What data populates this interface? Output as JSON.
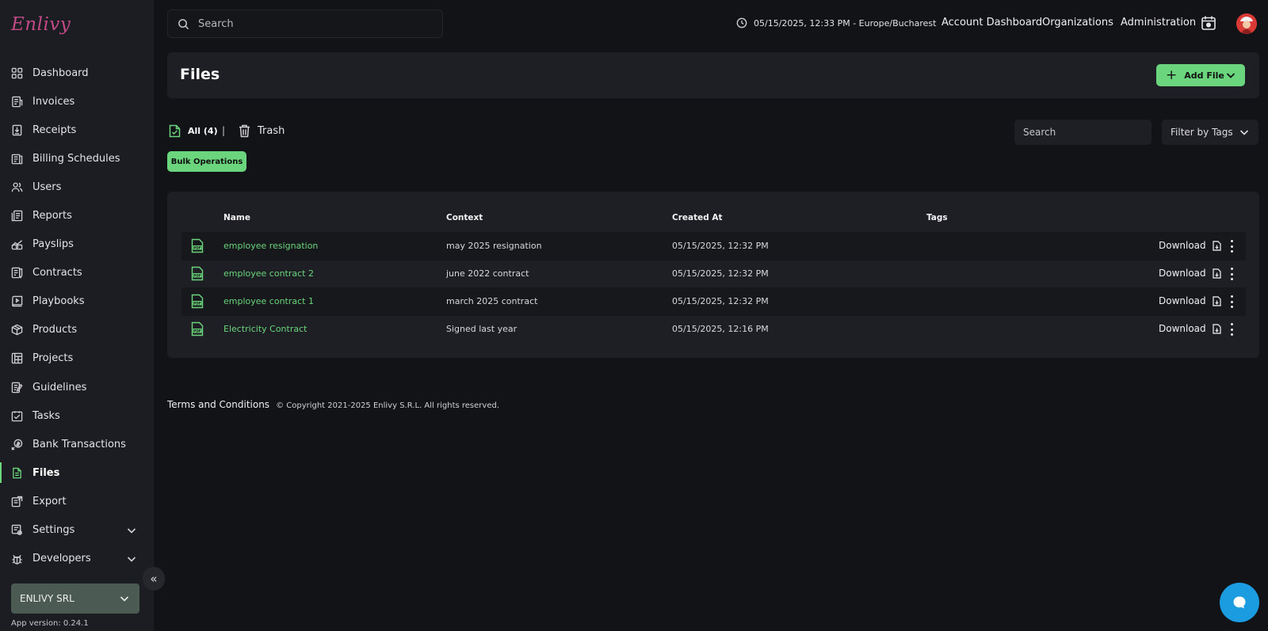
{
  "app": {
    "logo_text": "Enlivy",
    "org_name": "ENLIVY SRL",
    "app_version": "App version: 0.24.1"
  },
  "sidebar": {
    "items": [
      {
        "label": "Dashboard",
        "icon": "dashboard-icon"
      },
      {
        "label": "Invoices",
        "icon": "invoice-icon"
      },
      {
        "label": "Receipts",
        "icon": "receipt-icon"
      },
      {
        "label": "Billing Schedules",
        "icon": "billing-schedule-icon"
      },
      {
        "label": "Users",
        "icon": "users-icon"
      },
      {
        "label": "Reports",
        "icon": "reports-icon"
      },
      {
        "label": "Payslips",
        "icon": "payslips-icon"
      },
      {
        "label": "Contracts",
        "icon": "contracts-icon"
      },
      {
        "label": "Playbooks",
        "icon": "playbooks-icon"
      },
      {
        "label": "Products",
        "icon": "products-icon"
      },
      {
        "label": "Projects",
        "icon": "projects-icon"
      },
      {
        "label": "Guidelines",
        "icon": "guidelines-icon"
      },
      {
        "label": "Tasks",
        "icon": "tasks-icon"
      },
      {
        "label": "Bank Transactions",
        "icon": "bank-transactions-icon"
      },
      {
        "label": "Files",
        "icon": "files-icon",
        "active": true
      },
      {
        "label": "Export",
        "icon": "export-icon"
      },
      {
        "label": "Settings",
        "icon": "settings-icon",
        "expandable": true
      },
      {
        "label": "Developers",
        "icon": "developers-icon",
        "expandable": true
      }
    ]
  },
  "topbar": {
    "search_placeholder": "Search",
    "datetime": "05/15/2025, 12:33 PM  -  Europe/Bucharest",
    "nav": [
      "Account Dashboard",
      "Organizations",
      "Administration"
    ]
  },
  "page": {
    "title": "Files",
    "add_file_label": "Add File",
    "tab_all_label": "All (4)",
    "tab_separator": "|",
    "tab_trash_label": "Trash",
    "bulk_label": "Bulk Operations",
    "search_placeholder": "Search",
    "filter_tags_label": "Filter by Tags"
  },
  "table": {
    "headers": [
      "Name",
      "Context",
      "Created At",
      "Tags"
    ],
    "download_label": "Download",
    "rows": [
      {
        "name": "employee resignation",
        "context": "may 2025 resignation",
        "created_at": "05/15/2025, 12:32 PM",
        "tags": ""
      },
      {
        "name": "employee contract 2",
        "context": "june 2022 contract",
        "created_at": "05/15/2025, 12:32 PM",
        "tags": ""
      },
      {
        "name": "employee contract 1",
        "context": "march 2025 contract",
        "created_at": "05/15/2025, 12:32 PM",
        "tags": ""
      },
      {
        "name": "Electricity Contract",
        "context": "Signed last year",
        "created_at": "05/15/2025, 12:16 PM",
        "tags": ""
      }
    ]
  },
  "footer": {
    "terms": "Terms and Conditions",
    "copyright": "© Copyright 2021-2025 Enlivy S.R.L. All rights reserved."
  },
  "colors": {
    "accent": "#6ad57c",
    "background": "#121317",
    "panel": "#1e1f24",
    "chat": "#1b9be0"
  }
}
